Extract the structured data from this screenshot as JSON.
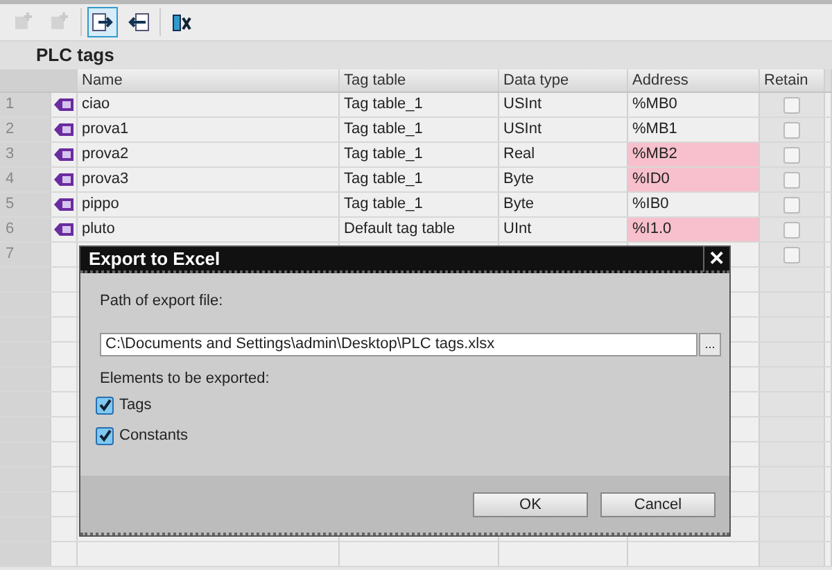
{
  "toolbar": {
    "buttons": [
      {
        "kind": "add",
        "selected": false,
        "disabled": true
      },
      {
        "kind": "add2",
        "selected": false,
        "disabled": true
      },
      {
        "kind": "export",
        "selected": true,
        "disabled": false
      },
      {
        "kind": "import",
        "selected": false,
        "disabled": false
      },
      {
        "kind": "clear",
        "selected": false,
        "disabled": false
      }
    ]
  },
  "title": "PLC tags",
  "table": {
    "columns": [
      "Name",
      "Tag table",
      "Data type",
      "Address",
      "Retain"
    ],
    "rows": [
      {
        "number": "1",
        "name": "ciao",
        "tag_table": "Tag table_1",
        "data_type": "USInt",
        "address": "%MB0",
        "address_error": false,
        "retain": false
      },
      {
        "number": "2",
        "name": "prova1",
        "tag_table": "Tag table_1",
        "data_type": "USInt",
        "address": "%MB1",
        "address_error": false,
        "retain": false
      },
      {
        "number": "3",
        "name": "prova2",
        "tag_table": "Tag table_1",
        "data_type": "Real",
        "address": "%MB2",
        "address_error": true,
        "retain": false
      },
      {
        "number": "4",
        "name": "prova3",
        "tag_table": "Tag table_1",
        "data_type": "Byte",
        "address": "%ID0",
        "address_error": true,
        "retain": false
      },
      {
        "number": "5",
        "name": "pippo",
        "tag_table": "Tag table_1",
        "data_type": "Byte",
        "address": "%IB0",
        "address_error": false,
        "retain": false
      },
      {
        "number": "6",
        "name": "pluto",
        "tag_table": "Default tag table",
        "data_type": "UInt",
        "address": "%I1.0",
        "address_error": true,
        "retain": false
      },
      {
        "number": "7",
        "retain": false
      }
    ]
  },
  "dialog": {
    "title": "Export to Excel",
    "close": "✕",
    "path_label": "Path of export file:",
    "path_value": "C:\\Documents and Settings\\admin\\Desktop\\PLC tags.xlsx",
    "browse": "...",
    "elements_label": "Elements to be exported:",
    "options": [
      {
        "label": "Tags",
        "checked": true
      },
      {
        "label": "Constants",
        "checked": true
      }
    ],
    "buttons": [
      "OK",
      "Cancel"
    ]
  }
}
